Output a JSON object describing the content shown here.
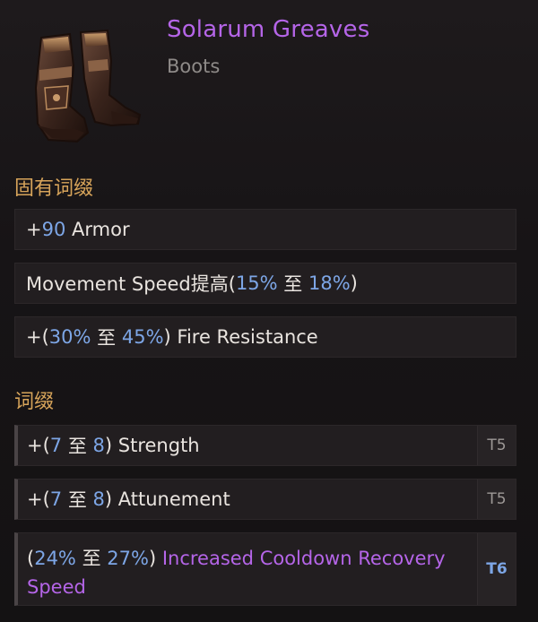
{
  "item": {
    "name": "Solarum Greaves",
    "type": "Boots"
  },
  "implicit": {
    "title": "固有词缀",
    "armor_prefix": "+",
    "armor_value": "90",
    "armor_label": " Armor",
    "ms_label": "Movement Speed提高(",
    "ms_min": "15%",
    "ms_to": " 至 ",
    "ms_max": "18%",
    "ms_close": ")",
    "fr_prefix": "+(",
    "fr_min": "30%",
    "fr_to": " 至 ",
    "fr_max": "45%",
    "fr_label": ") Fire Resistance"
  },
  "affixes": {
    "title": "词缀",
    "str_prefix": "+(",
    "str_min": "7",
    "str_to": " 至 ",
    "str_max": "8",
    "str_label": ") Strength",
    "str_tier": "T5",
    "att_prefix": "+(",
    "att_min": "7",
    "att_to": " 至 ",
    "att_max": "8",
    "att_label": ") Attunement",
    "att_tier": "T5",
    "cd_prefix": "(",
    "cd_min": "24%",
    "cd_to": " 至 ",
    "cd_max": "27%",
    "cd_close": ") ",
    "cd_label": "Increased Cooldown Recovery Speed",
    "cd_tier": "T6"
  },
  "colors": {
    "rarity_purple": "#b565e8",
    "section_gold": "#d7a45a",
    "value_blue": "#7da6e6"
  },
  "icon": "boots-icon"
}
